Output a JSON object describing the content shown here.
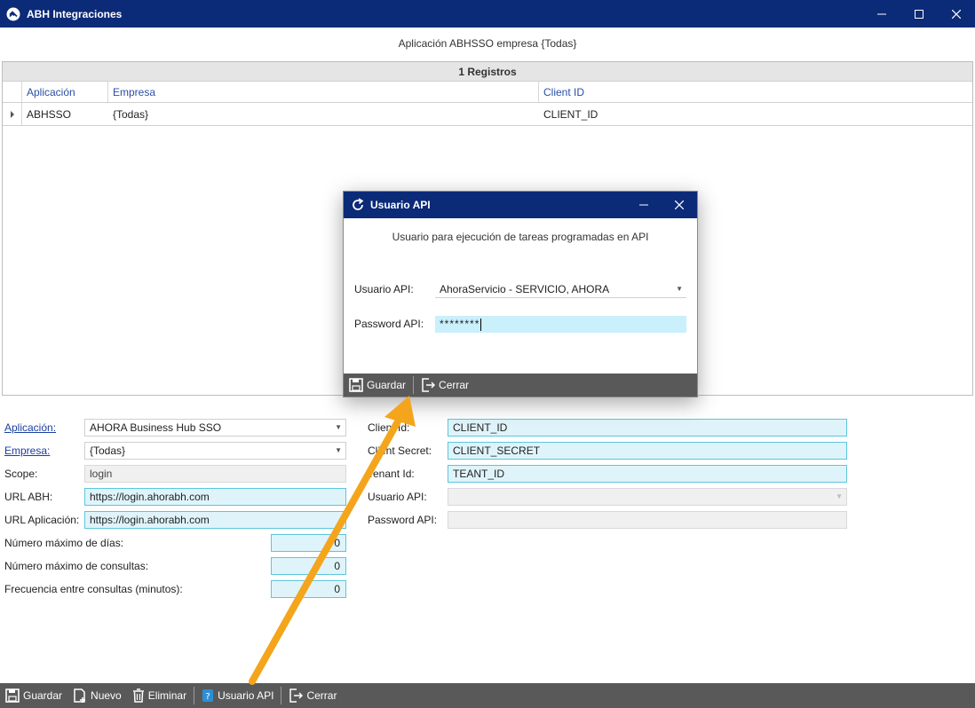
{
  "window": {
    "title": "ABH Integraciones"
  },
  "subtitle": "Aplicación ABHSSO empresa {Todas}",
  "grid": {
    "header": "1 Registros",
    "columns": [
      "Aplicación",
      "Empresa",
      "Client ID"
    ],
    "rows": [
      {
        "aplicacion": "ABHSSO",
        "empresa": "{Todas}",
        "client_id": "CLIENT_ID"
      }
    ]
  },
  "form": {
    "aplicacion": {
      "label": "Aplicación:",
      "value": "AHORA Business Hub SSO"
    },
    "empresa": {
      "label": "Empresa:",
      "value": "{Todas}"
    },
    "scope": {
      "label": "Scope:",
      "value": "login"
    },
    "url_abh": {
      "label": "URL ABH:",
      "value": "https://login.ahorabh.com"
    },
    "url_aplicacion": {
      "label": "URL Aplicación:",
      "value": "https://login.ahorabh.com"
    },
    "max_dias": {
      "label": "Número máximo de días:",
      "value": "0"
    },
    "max_consultas": {
      "label": "Número máximo de consultas:",
      "value": "0"
    },
    "frecuencia": {
      "label": "Frecuencia entre consultas (minutos):",
      "value": "0"
    },
    "client_id": {
      "label": "Client Id:",
      "value": "CLIENT_ID"
    },
    "client_secret": {
      "label": "Client Secret:",
      "value": "CLIENT_SECRET"
    },
    "tenant_id": {
      "label": "Tenant Id:",
      "value": "TEANT_ID"
    },
    "usuario_api": {
      "label": "Usuario API:",
      "value": ""
    },
    "password_api": {
      "label": "Password API:",
      "value": ""
    }
  },
  "toolbar": {
    "guardar": "Guardar",
    "nuevo": "Nuevo",
    "eliminar": "Eliminar",
    "usuario_api": "Usuario API",
    "cerrar": "Cerrar"
  },
  "dialog": {
    "title": "Usuario API",
    "subtitle": "Usuario para ejecución de tareas programadas en API",
    "usuario_label": "Usuario API:",
    "usuario_value": "AhoraServicio - SERVICIO, AHORA",
    "password_label": "Password API:",
    "password_value": "********",
    "guardar": "Guardar",
    "cerrar": "Cerrar"
  },
  "colors": {
    "titlebar": "#0b2a78",
    "toolbar": "#595959",
    "field_border": "#5cc6dc",
    "field_bg": "#dff4fa",
    "arrow": "#f4a51c"
  }
}
